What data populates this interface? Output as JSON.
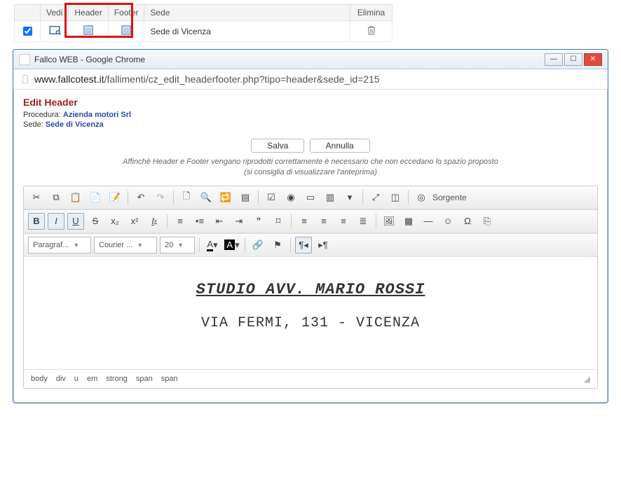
{
  "table": {
    "headers": {
      "vedi": "Vedi",
      "header": "Header",
      "footer": "Footer",
      "sede": "Sede",
      "elimina": "Elimina"
    },
    "row": {
      "sede": "Sede di Vicenza"
    }
  },
  "window": {
    "title": "Fallco WEB - Google Chrome",
    "url": {
      "host": "www.fallcotest.it",
      "path": "/fallimenti/cz_edit_headerfooter.php?tipo=header&sede_id=215"
    }
  },
  "page": {
    "title": "Edit Header",
    "procedura_label": "Procedura:",
    "procedura_value": "Azienda motori Srl",
    "sede_label": "Sede:",
    "sede_value": "Sede di Vicenza",
    "save": "Salva",
    "cancel": "Annulla",
    "note_line1": "Affinchè Header e Footer vengano riprodotti correttamente è necessario che non eccedano lo spazio proposto",
    "note_line2": "(si consiglia di visualizzare l'anteprima)"
  },
  "editor": {
    "source_label": "Sorgente",
    "format_combo": "Paragraf...",
    "font_combo": "Courier ...",
    "size_combo": "20",
    "content_line1": "STUDIO AVV. MARIO ROSSI",
    "content_line2": "VIA FERMI, 131 - VICENZA",
    "path": [
      "body",
      "div",
      "u",
      "em",
      "strong",
      "span",
      "span"
    ]
  }
}
